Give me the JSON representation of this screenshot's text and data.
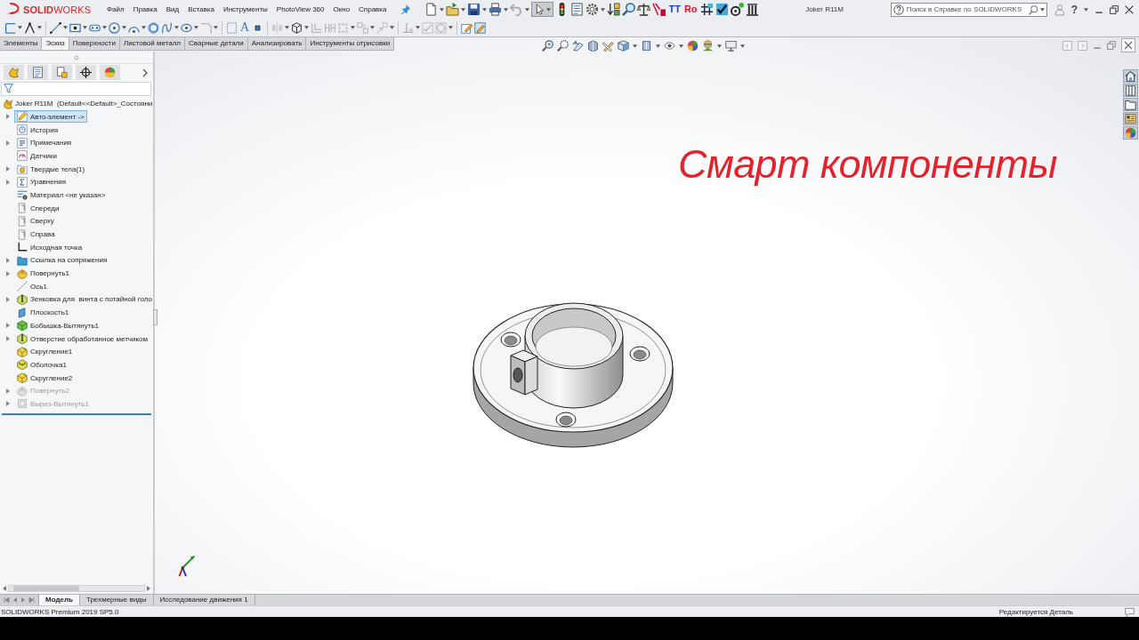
{
  "window": {
    "logo": "**SOLID**WORKS",
    "menu": [
      "Файл",
      "Правка",
      "Вид",
      "Вставка",
      "Инструменты",
      "PhotoView 360",
      "Окно",
      "Справка"
    ],
    "title": "Joker R11M",
    "search": {
      "placeholder": "Поиск в Справке по SOLIDWORKS"
    },
    "help_button": "?"
  },
  "quick_toolbar": {
    "select_tool": {
      "on": true
    },
    "glyph_buttons": [
      {
        "text": "TT",
        "color": "#1f3fc8"
      },
      {
        "text": "Ro",
        "color": "#d0192a"
      }
    ]
  },
  "sketch_toolbar": {
    "text_tool": "A"
  },
  "command_tabs": [
    {
      "label": "Элементы",
      "selected": false
    },
    {
      "label": "Эскиз",
      "selected": true
    },
    {
      "label": "Поверхности",
      "selected": false
    },
    {
      "label": "Листовой металл",
      "selected": false
    },
    {
      "label": "Сварные детали",
      "selected": false
    },
    {
      "label": "Анализировать",
      "selected": false
    },
    {
      "label": "Инструменты отрисовки",
      "selected": false
    }
  ],
  "feature_tree": {
    "root": "Joker R11M  (Default<<Default>_Состояни",
    "items": [
      {
        "label": "Авто-элемент ->",
        "kind": "autofeature",
        "expandable": true,
        "selected": true,
        "suppressed": false
      },
      {
        "label": "История",
        "kind": "history",
        "expandable": false,
        "selected": false,
        "suppressed": false
      },
      {
        "label": "Примечания",
        "kind": "annotations",
        "expandable": true,
        "selected": false,
        "suppressed": false
      },
      {
        "label": "Датчики",
        "kind": "sensors",
        "expandable": false,
        "selected": false,
        "suppressed": false
      },
      {
        "label": "Твердые тела(1)",
        "kind": "bodies",
        "expandable": true,
        "selected": false,
        "suppressed": false
      },
      {
        "label": "Уравнения",
        "kind": "equations",
        "expandable": true,
        "selected": false,
        "suppressed": false
      },
      {
        "label": "Материал <не указан>",
        "kind": "material",
        "expandable": false,
        "selected": false,
        "suppressed": false
      },
      {
        "label": "Спереди",
        "kind": "plane",
        "expandable": false,
        "selected": false,
        "suppressed": false
      },
      {
        "label": "Сверху",
        "kind": "plane",
        "expandable": false,
        "selected": false,
        "suppressed": false
      },
      {
        "label": "Справа",
        "kind": "plane",
        "expandable": false,
        "selected": false,
        "suppressed": false
      },
      {
        "label": "Исходная точка",
        "kind": "origin",
        "expandable": false,
        "selected": false,
        "suppressed": false
      },
      {
        "label": "Ссылка на сопряжения",
        "kind": "mates",
        "expandable": true,
        "selected": false,
        "suppressed": false
      },
      {
        "label": "Повернуть1",
        "kind": "revolve",
        "expandable": true,
        "selected": false,
        "suppressed": false
      },
      {
        "label": "Ось1",
        "kind": "axis",
        "expandable": false,
        "selected": false,
        "suppressed": false
      },
      {
        "label": "Зенковка для  винта с потайной голо",
        "kind": "hole",
        "expandable": true,
        "selected": false,
        "suppressed": false
      },
      {
        "label": "Плоскость1",
        "kind": "ref_plane",
        "expandable": false,
        "selected": false,
        "suppressed": false
      },
      {
        "label": "Бобышка-Вытянуть1",
        "kind": "boss",
        "expandable": true,
        "selected": false,
        "suppressed": false
      },
      {
        "label": "Отверстие обработанное метчиком",
        "kind": "hole",
        "expandable": true,
        "selected": false,
        "suppressed": false
      },
      {
        "label": "Скругление1",
        "kind": "fillet",
        "expandable": false,
        "selected": false,
        "suppressed": false
      },
      {
        "label": "Оболочка1",
        "kind": "shell",
        "expandable": false,
        "selected": false,
        "suppressed": false
      },
      {
        "label": "Скругление2",
        "kind": "fillet",
        "expandable": false,
        "selected": false,
        "suppressed": false
      },
      {
        "label": "Повернуть2",
        "kind": "revolve",
        "expandable": true,
        "selected": false,
        "suppressed": true
      },
      {
        "label": "Вырез-Вытянуть1",
        "kind": "cut",
        "expandable": true,
        "selected": false,
        "suppressed": true
      }
    ]
  },
  "graphics": {
    "caption": "Смарт компоненты"
  },
  "bottom_tabs": [
    {
      "label": "Модель",
      "selected": true
    },
    {
      "label": "Трехмерные виды",
      "selected": false
    },
    {
      "label": "Исследование движения 1",
      "selected": false
    }
  ],
  "status_bar": {
    "product": "SOLIDWORKS Premium 2019 SP5.0",
    "mode": "Редактируется Деталь"
  }
}
